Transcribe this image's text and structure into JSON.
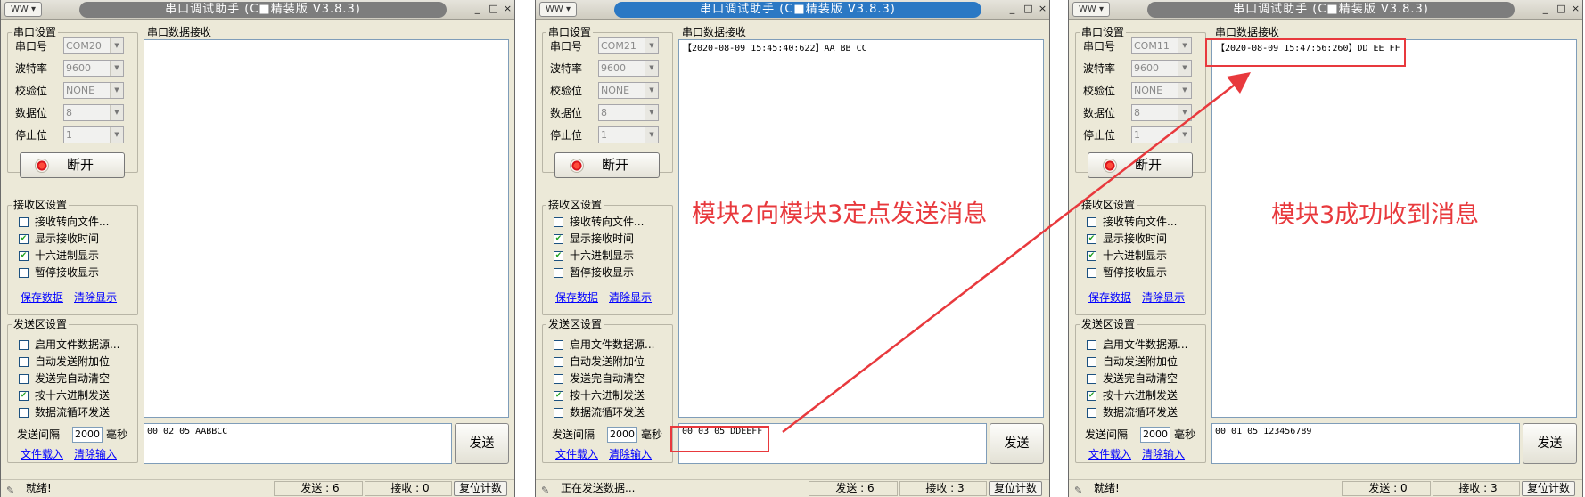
{
  "windows": [
    {
      "title": "串口调试助手 (C■精装版 V3.8.3)",
      "active": false,
      "port": "COM20",
      "baud": "9600",
      "parity": "NONE",
      "databits": "8",
      "stopbits": "1",
      "recv_text": "",
      "send_text": "00 02 05 AABBCC",
      "interval": "2000",
      "status_text": "就绪!",
      "sent_count": "发送 : 6",
      "recv_count": "接收 : 0",
      "checks": {
        "recv_to_file": false,
        "show_time": true,
        "hex_show": true,
        "pause": false,
        "file_src": false,
        "auto_append": false,
        "auto_clear": false,
        "hex_send": true,
        "loop_send": false
      }
    },
    {
      "title": "串口调试助手 (C■精装版 V3.8.3)",
      "active": true,
      "port": "COM21",
      "baud": "9600",
      "parity": "NONE",
      "databits": "8",
      "stopbits": "1",
      "recv_text": "【2020-08-09 15:45:40:622】AA BB CC",
      "send_text": "00 03 05 DDEEFF",
      "interval": "2000",
      "status_text": "正在发送数据...",
      "sent_count": "发送 : 6",
      "recv_count": "接收 : 3",
      "checks": {
        "recv_to_file": false,
        "show_time": true,
        "hex_show": true,
        "pause": false,
        "file_src": false,
        "auto_append": false,
        "auto_clear": false,
        "hex_send": true,
        "loop_send": false
      }
    },
    {
      "title": "串口调试助手 (C■精装版 V3.8.3)",
      "active": false,
      "port": "COM11",
      "baud": "9600",
      "parity": "NONE",
      "databits": "8",
      "stopbits": "1",
      "recv_text": "【2020-08-09 15:47:56:260】DD EE FF",
      "send_text": "00 01 05 123456789",
      "interval": "2000",
      "status_text": "就绪!",
      "sent_count": "发送 : 0",
      "recv_count": "接收 : 3",
      "checks": {
        "recv_to_file": false,
        "show_time": true,
        "hex_show": true,
        "pause": false,
        "file_src": false,
        "auto_append": false,
        "auto_clear": false,
        "hex_send": true,
        "loop_send": false
      }
    }
  ],
  "labels": {
    "serial_settings": "串口设置",
    "port": "串口号",
    "baud": "波特率",
    "parity": "校验位",
    "databits": "数据位",
    "stopbits": "停止位",
    "disconnect": "断开",
    "recv_settings": "接收区设置",
    "recv_to_file": "接收转向文件...",
    "show_time": "显示接收时间",
    "hex_show": "十六进制显示",
    "pause": "暂停接收显示",
    "save_data": "保存数据",
    "clear_display": "清除显示",
    "send_settings": "发送区设置",
    "file_src": "启用文件数据源...",
    "auto_append": "自动发送附加位",
    "auto_clear": "发送完自动清空",
    "hex_send": "按十六进制发送",
    "loop_send": "数据流循环发送",
    "interval": "发送间隔",
    "ms": "毫秒",
    "load_file": "文件载入",
    "clear_input": "清除输入",
    "recv_area": "串口数据接收",
    "send": "发送",
    "reset_count": "复位计数",
    "sysmenu": "WW ▾",
    "min": "_",
    "max": "□",
    "close": "×"
  },
  "annotations": {
    "left": "模块2向模块3定点发送消息",
    "right": "模块3成功收到消息"
  },
  "colors": {
    "annotation": "#e8393d",
    "active_title": "#2b78c4",
    "inactive_title": "#7d7d7d"
  }
}
